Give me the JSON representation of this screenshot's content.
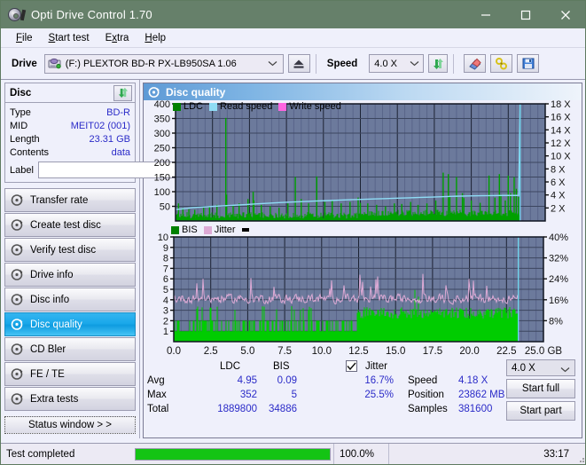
{
  "window": {
    "title": "Opti Drive Control 1.70",
    "icon": "disc-pen-icon",
    "minimize": "—",
    "maximize": "□",
    "close": "✕",
    "titlebar_color": "#66806a"
  },
  "menu": {
    "items": [
      {
        "label": "File",
        "accel": "F"
      },
      {
        "label": "Start test",
        "accel": "S"
      },
      {
        "label": "Extra",
        "accel": "x"
      },
      {
        "label": "Help",
        "accel": "H"
      }
    ]
  },
  "toolbar": {
    "drive_label": "Drive",
    "drive_value": "(F:)   PLEXTOR BD-R  PX-LB950SA 1.06",
    "eject_icon": "eject-icon",
    "speed_label": "Speed",
    "speed_value": "4.0 X",
    "refresh_icon": "refresh-icon",
    "eraser_icon": "eraser-icon",
    "tools_icon": "tools-icon",
    "save_icon": "save-icon"
  },
  "disc_panel": {
    "title": "Disc",
    "refresh_icon": "refresh-icon",
    "rows": [
      {
        "key": "Type",
        "value": "BD-R"
      },
      {
        "key": "MID",
        "value": "MEIT02 (001)"
      },
      {
        "key": "Length",
        "value": "23.31 GB"
      },
      {
        "key": "Contents",
        "value": "data"
      }
    ],
    "label_key": "Label",
    "label_value": "",
    "label_placeholder": "",
    "disc_icon": "disc-icon"
  },
  "sidebar": {
    "items": [
      {
        "label": "Transfer rate",
        "icon": "disc-icon",
        "active": false
      },
      {
        "label": "Create test disc",
        "icon": "disc-icon",
        "active": false
      },
      {
        "label": "Verify test disc",
        "icon": "disc-icon",
        "active": false
      },
      {
        "label": "Drive info",
        "icon": "disc-icon",
        "active": false
      },
      {
        "label": "Disc info",
        "icon": "disc-icon",
        "active": false
      },
      {
        "label": "Disc quality",
        "icon": "disc-icon",
        "active": true
      },
      {
        "label": "CD Bler",
        "icon": "disc-icon",
        "active": false
      },
      {
        "label": "FE / TE",
        "icon": "disc-icon",
        "active": false
      },
      {
        "label": "Extra tests",
        "icon": "disc-icon",
        "active": false
      }
    ],
    "status_window": "Status window > >"
  },
  "panel": {
    "title": "Disc quality",
    "icon": "disc-icon"
  },
  "stats": {
    "col_ldc": "LDC",
    "col_bis": "BIS",
    "jitter_label": "Jitter",
    "jitter_checked": true,
    "rows": [
      {
        "name": "Avg",
        "ldc": "4.95",
        "bis": "0.09",
        "jitter": "16.7%"
      },
      {
        "name": "Max",
        "ldc": "352",
        "bis": "5",
        "jitter": "25.5%"
      },
      {
        "name": "Total",
        "ldc": "1889800",
        "bis": "34886",
        "jitter": ""
      }
    ],
    "speed_label": "Speed",
    "speed_value": "4.18 X",
    "position_label": "Position",
    "position_value": "23862 MB",
    "samples_label": "Samples",
    "samples_value": "381600",
    "speed_select": "4.0 X",
    "start_full": "Start full",
    "start_part": "Start part"
  },
  "statusbar": {
    "message": "Test completed",
    "percent_text": "100.0%",
    "percent_value": 100,
    "time": "33:17"
  },
  "colors": {
    "ldc_green": "#00a000",
    "bis_green": "#00cc00",
    "read_speed": "#8fdcf5",
    "write_speed": "#ff66e0",
    "jitter_pink": "#ddaad5",
    "plot_bg": "#6c7a9c",
    "accent_blue": "#2b2bc8"
  },
  "chart_data": [
    {
      "type": "line",
      "name": "ldc-chart",
      "title": "",
      "xlabel": "GB",
      "ylabel": "",
      "xlim": [
        0,
        25
      ],
      "xticks": [
        "0.0",
        "2.5",
        "5.0",
        "7.5",
        "10.0",
        "12.5",
        "15.0",
        "17.5",
        "20.0",
        "22.5",
        "25.0 GB"
      ],
      "ylim": [
        0,
        400
      ],
      "yticks": [
        50,
        100,
        150,
        200,
        250,
        300,
        350,
        400
      ],
      "y2lim": [
        0,
        18
      ],
      "y2ticks": [
        "2 X",
        "4 X",
        "6 X",
        "8 X",
        "10 X",
        "12 X",
        "14 X",
        "16 X",
        "18 X"
      ],
      "grid": true,
      "legend": [
        {
          "label": "LDC",
          "color": "#008000"
        },
        {
          "label": "Read speed",
          "color": "#8fdcf5"
        },
        {
          "label": "Write speed",
          "color": "#ff66e0"
        }
      ],
      "series": [
        {
          "name": "LDC",
          "type": "impulse",
          "color": "#00a000",
          "baseline": 20,
          "spikes_x": [
            0.2,
            0.5,
            0.9,
            1.3,
            1.9,
            2.3,
            2.8,
            3.4,
            3.45,
            3.9,
            4.3,
            4.9,
            5.25,
            5.3,
            5.8,
            6.4,
            7.0,
            7.6,
            8.1,
            8.5,
            9.0,
            9.55,
            10.1,
            10.6,
            11.2,
            11.8,
            12.35,
            12.5,
            13.0,
            13.6,
            14.2,
            14.8,
            15.3,
            15.9,
            16.4,
            17.0,
            17.6,
            18.1,
            18.45,
            18.55,
            19.0,
            19.4,
            19.5,
            20.0,
            20.6,
            21.2,
            21.6,
            21.9,
            22.0,
            22.3,
            22.5,
            22.65,
            22.9,
            23.05,
            23.2
          ],
          "spikes_y": [
            60,
            45,
            40,
            38,
            45,
            50,
            55,
            352,
            90,
            55,
            60,
            75,
            100,
            70,
            55,
            50,
            45,
            60,
            150,
            75,
            60,
            152,
            65,
            70,
            60,
            65,
            80,
            62,
            60,
            55,
            50,
            60,
            58,
            65,
            55,
            60,
            70,
            165,
            160,
            82,
            150,
            95,
            78,
            70,
            62,
            155,
            80,
            160,
            90,
            70,
            155,
            95,
            150,
            110,
            82
          ]
        },
        {
          "name": "Read speed",
          "type": "line",
          "color": "#8fdcf5",
          "x": [
            0.0,
            0.6,
            1.2,
            2.0,
            2.6,
            3.2,
            4.0,
            4.6,
            5.4,
            6.2,
            7.0,
            7.8,
            8.6,
            9.4,
            10.2,
            11.0,
            11.8,
            12.6,
            13.4,
            14.2,
            15.0,
            15.8,
            16.6,
            17.4,
            18.2,
            19.0,
            19.8,
            20.6,
            21.4,
            22.2,
            23.2,
            23.25,
            23.3
          ],
          "y": [
            1.75,
            1.9,
            2.05,
            2.15,
            2.25,
            2.32,
            2.42,
            2.5,
            2.62,
            2.72,
            2.82,
            2.9,
            2.98,
            3.06,
            3.12,
            3.2,
            3.26,
            3.32,
            3.38,
            3.44,
            3.5,
            3.56,
            3.62,
            3.68,
            3.74,
            3.8,
            3.84,
            3.88,
            3.9,
            3.92,
            3.92,
            10.0,
            18.0
          ]
        }
      ]
    },
    {
      "type": "line",
      "name": "bis-chart",
      "title": "",
      "xlabel": "GB",
      "ylabel": "",
      "xlim": [
        0,
        25
      ],
      "xticks": [
        "0.0",
        "2.5",
        "5.0",
        "7.5",
        "10.0",
        "12.5",
        "15.0",
        "17.5",
        "20.0",
        "22.5",
        "25.0 GB"
      ],
      "ylim": [
        0,
        10
      ],
      "yticks": [
        1,
        2,
        3,
        4,
        5,
        6,
        7,
        8,
        9,
        10
      ],
      "y2lim": [
        0,
        40
      ],
      "y2ticks": [
        "8%",
        "16%",
        "24%",
        "32%",
        "40%"
      ],
      "grid": true,
      "legend": [
        {
          "label": "BIS",
          "color": "#008000"
        },
        {
          "label": "Jitter",
          "color": "#ddaad5"
        }
      ],
      "series": [
        {
          "name": "BIS",
          "type": "impulse",
          "color": "#00cc00",
          "baseline_before_12_5": 1.0,
          "baseline_after_12_5": 2.2,
          "max": 5
        },
        {
          "name": "Jitter",
          "type": "line",
          "color": "#ddaad5",
          "avg_percent": 16.7,
          "max_percent": 25.5,
          "baseline": 4.1
        }
      ]
    }
  ]
}
